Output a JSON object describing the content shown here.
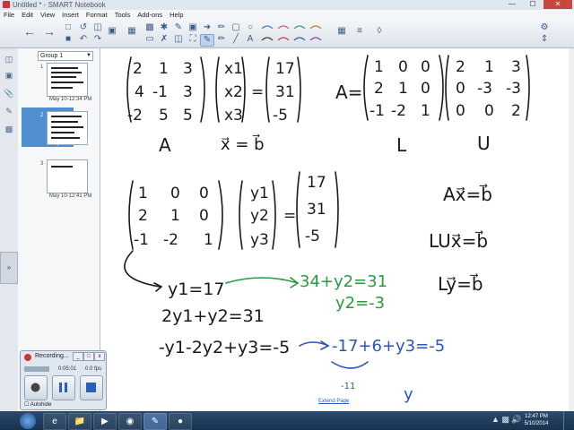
{
  "window": {
    "title": "Untitled * - SMART Notebook",
    "controls": {
      "minimize": "—",
      "maximize": "☐",
      "close": "✕"
    }
  },
  "menu": [
    "File",
    "Edit",
    "View",
    "Insert",
    "Format",
    "Tools",
    "Add-ons",
    "Help"
  ],
  "toolbar": {
    "icons_row1": [
      "back-icon",
      "forward-icon",
      "add-page-icon",
      "delete-page-icon",
      "screen-shade-icon",
      "document-camera-icon",
      "table-icon",
      "fullscreen-icon",
      "select-icon",
      "pen-icon",
      "creative-pen-icon",
      "eraser-icon",
      "line-icon",
      "shapes-icon",
      "text-icon",
      "fill-icon",
      "properties-icon",
      "settings-icon"
    ],
    "pen_styles": 8,
    "colors": [
      "#1e1e1e",
      "#c33030",
      "#2c55b8",
      "#2a9a3c",
      "#e0a020",
      "#8a3cb0"
    ]
  },
  "sorter": {
    "group": "Group 1",
    "pages": [
      {
        "label": "May 10-12:34 PM",
        "num": "1"
      },
      {
        "label": "May 10-12:38 PM",
        "num": "2"
      },
      {
        "label": "May 10-12:41 PM",
        "num": "3"
      }
    ]
  },
  "canvas": {
    "extend_page": "Extend Page",
    "ink": {
      "matA": [
        "2",
        "1",
        "3",
        "4",
        "-1",
        "3",
        "-2",
        "5",
        "5"
      ],
      "vecX": [
        "x1",
        "x2",
        "x3"
      ],
      "vecB": [
        "17",
        "31",
        "-5"
      ],
      "labelA": "A",
      "labelXB": "x⃗ = b⃗",
      "A_eq": "A=",
      "matL": [
        "1",
        "0",
        "0",
        "2",
        "1",
        "0",
        "-1",
        "-2",
        "1"
      ],
      "matU": [
        "2",
        "1",
        "3",
        "0",
        "-3",
        "-3",
        "0",
        "0",
        "2"
      ],
      "labelL": "L",
      "labelU": "U",
      "mat2": [
        "1",
        "0",
        "0",
        "2",
        "1",
        "0",
        "-1",
        "-2",
        "1"
      ],
      "vecY": [
        "y1",
        "y2",
        "y3"
      ],
      "vecB2": [
        "17",
        "31",
        "-5"
      ],
      "eqAxb": "Ax⃗=b⃗",
      "eqLUxb": "LUx⃗=b⃗",
      "eqLyb": "Ly⃗=b⃗",
      "line1": "y1=17",
      "line2": "2y1+y2=31",
      "line3": "-y1-2y2+y3=-5",
      "green1": "34+y2=31",
      "green2": "y2=-3",
      "blue1": "-17+6+y3=-5",
      "blue_sub": "-11",
      "blue_y": "y"
    }
  },
  "recorder": {
    "title": "Recording...",
    "time": "0:05:01",
    "size": "0.0 fps",
    "autohide": "Autohide",
    "controls": {
      "min": "_",
      "max": "□",
      "close": "x"
    }
  },
  "taskbar": {
    "apps": [
      "ie-icon",
      "folder-icon",
      "media-player-icon",
      "chrome-icon",
      "smart-notebook-icon",
      "recorder-icon"
    ],
    "time": "12:47 PM",
    "date": "5/10/2014"
  }
}
